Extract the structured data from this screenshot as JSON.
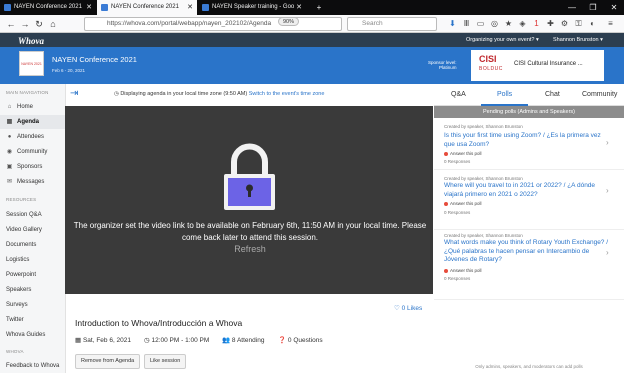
{
  "browser": {
    "tabs": [
      {
        "label": "NAYEN Conference 2021",
        "active": false
      },
      {
        "label": "NAYEN Conference 2021",
        "active": true
      },
      {
        "label": "NAYEN Speaker training - Goo",
        "active": false
      }
    ],
    "new_tab": "+",
    "url": "https://whova.com/portal/webapp/nayen_202102/Agenda",
    "zoom": "90%",
    "search_placeholder": "Search",
    "notification_count": "1"
  },
  "app": {
    "logo": "Whova",
    "organize_prompt": "Organizing your own event? ▾",
    "user_name": "Shannon Brunston ▾"
  },
  "event": {
    "title": "NAYEN Conference 2021",
    "dates": "Feb 6 - 20, 2021",
    "logo_text": "NAYEN 2021",
    "sponsor_level_label": "Sponsor level:",
    "sponsor_level": "Platinum",
    "sponsor_logo_main": "CISI",
    "sponsor_logo_sub": "BOLDUC",
    "sponsor_name": "CISI Cultural Insurance ..."
  },
  "sidebar": {
    "main_nav_header": "MAIN NAVIGATION",
    "main_items": [
      {
        "label": "Home",
        "icon": "home-icon"
      },
      {
        "label": "Agenda",
        "icon": "calendar-icon",
        "active": true
      },
      {
        "label": "Attendees",
        "icon": "people-icon"
      },
      {
        "label": "Community",
        "icon": "community-icon"
      },
      {
        "label": "Sponsors",
        "icon": "sponsors-icon"
      },
      {
        "label": "Messages",
        "icon": "messages-icon"
      }
    ],
    "resources_header": "RESOURCES",
    "resource_items": [
      "Session Q&A",
      "Video Gallery",
      "Documents",
      "Logistics",
      "Powerpoint",
      "Speakers",
      "Surveys",
      "Twitter",
      "Whova Guides"
    ],
    "whova_header": "WHOVA",
    "whova_items": [
      "Feedback to Whova"
    ]
  },
  "main": {
    "tz_text": "Displaying agenda in your local time zone (9:50 AM)",
    "tz_link": "Switch to the event's time zone",
    "video_message_line1": "The organizer set the video link to be available on February 6th, 11:50 AM in your local time. Please",
    "video_message_line2": "come back later to attend this session.",
    "refresh_label": "Refresh",
    "likes": "0 Likes",
    "session_title": "Introduction to Whova/Introducción a Whova",
    "date": "Sat, Feb 6, 2021",
    "time": "12:00 PM - 1:00 PM",
    "attending": "8 Attending",
    "questions": "0 Questions",
    "remove_button": "Remove from Agenda",
    "like_button": "Like session"
  },
  "right_panel": {
    "tabs": [
      "Q&A",
      "Polls",
      "Chat",
      "Community"
    ],
    "active_tab": "Polls",
    "pending_header": "Pending polls (Admins and Speakers)",
    "polls": [
      {
        "creator": "Created by speaker, Shannon Brunston",
        "question": "Is this your first time using Zoom? / ¿Es la primera vez que usa Zoom?",
        "answer_label": "Answer this poll",
        "responses": "0 Responses"
      },
      {
        "creator": "Created by speaker, Shannon Brunston",
        "question": "Where will you travel to in 2021 or 2022? / ¿A dónde viajará primero en 2021 o 2022?",
        "answer_label": "Answer this poll",
        "responses": "0 Responses"
      },
      {
        "creator": "Created by speaker, Shannon Brunston",
        "question": "What words make you think of Rotary Youth Exchange? / ¿Qué palabras te hacen pensar en Intercambio de Jóvenes de Rotary?",
        "answer_label": "Answer this poll",
        "responses": "0 Responses"
      }
    ],
    "footnote": "Only admins, speakers, and moderators can add polls"
  },
  "colors": {
    "brand_blue": "#2a74c9",
    "whova_bar": "#2c3e50",
    "video_bg": "#3a3a3a",
    "lock_purple": "#6c63e6"
  }
}
